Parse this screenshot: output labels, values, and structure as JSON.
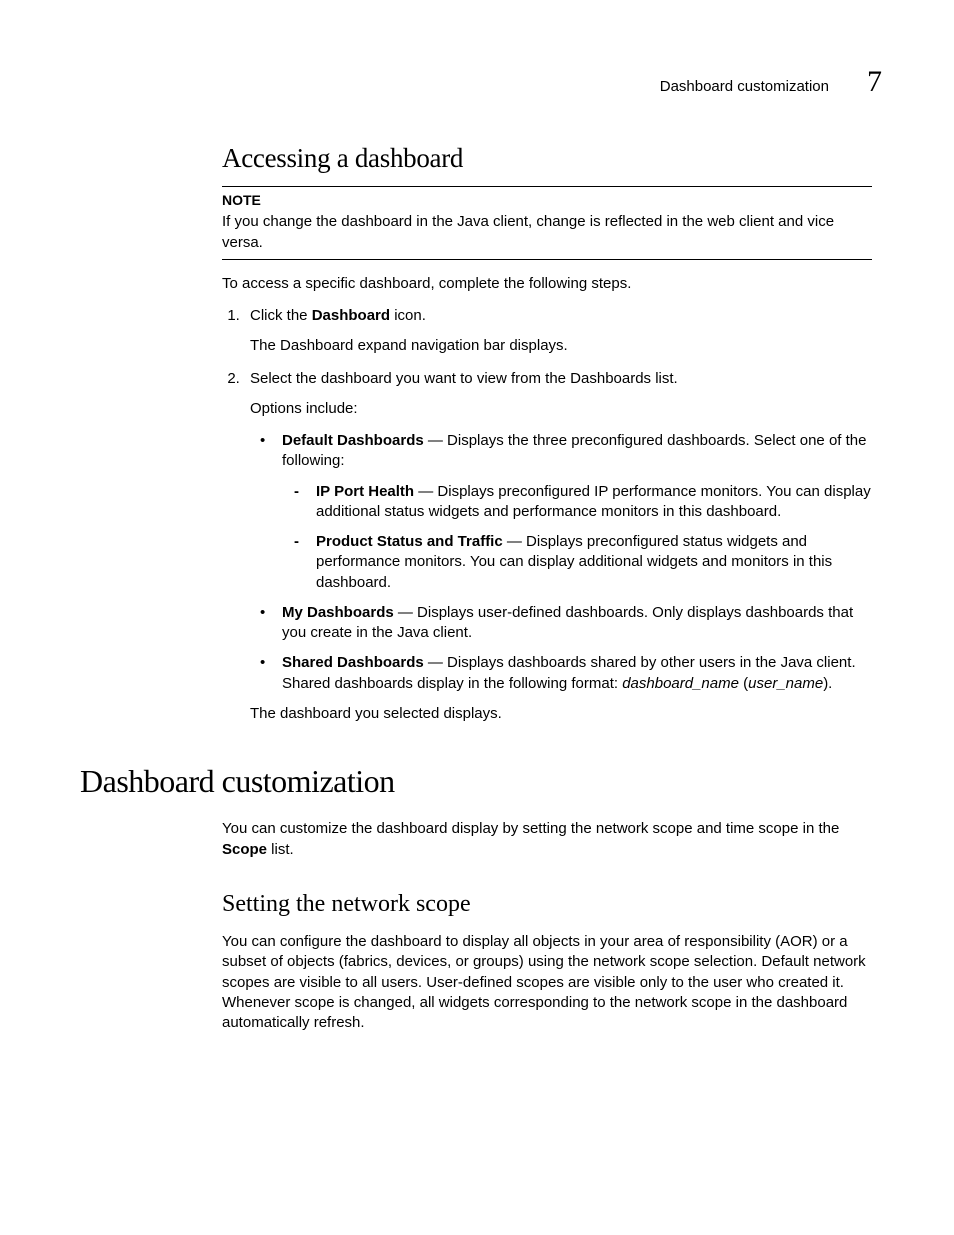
{
  "header": {
    "running_title": "Dashboard customization",
    "chapter_number": "7"
  },
  "section1": {
    "heading": "Accessing a dashboard",
    "note_label": "NOTE",
    "note_text": "If you change the dashboard in the Java client, change is reflected in the web client and vice versa.",
    "intro": "To access a specific dashboard, complete the following steps.",
    "step1_pre": "Click the ",
    "step1_bold": "Dashboard",
    "step1_post": " icon.",
    "step1_result": "The Dashboard expand navigation bar displays.",
    "step2": "Select the dashboard you want to view from the Dashboards list.",
    "step2_options_label": "Options include:",
    "opt_default_label": "Default Dashboards",
    "opt_default_text": " — Displays the three preconfigured dashboards. Select one of the following:",
    "opt_ip_label": "IP Port Health",
    "opt_ip_text": " — Displays preconfigured IP performance monitors. You can display additional status widgets and performance monitors in this dashboard.",
    "opt_prod_label": "Product Status and Traffic",
    "opt_prod_text": " — Displays preconfigured status widgets and performance monitors. You can display additional widgets and monitors in this dashboard.",
    "opt_my_label": "My Dashboards",
    "opt_my_text": " — Displays user-defined dashboards. Only displays dashboards that you create in the Java client.",
    "opt_shared_label": "Shared Dashboards",
    "opt_shared_text_pre": " — Displays dashboards shared by other users in the Java client. Shared dashboards display in the following format: ",
    "opt_shared_italic1": "dashboard_name",
    "opt_shared_mid": " (",
    "opt_shared_italic2": "user_name",
    "opt_shared_end": ").",
    "step2_result": "The dashboard you selected displays."
  },
  "section2": {
    "heading": "Dashboard customization",
    "para_pre": "You can customize the dashboard display by setting the network scope and time scope in the ",
    "para_bold": "Scope",
    "para_post": " list.",
    "sub_heading": "Setting the network scope",
    "sub_para": "You can configure the dashboard to display all objects in your area of responsibility (AOR) or a subset of objects (fabrics, devices, or groups) using the network scope selection. Default network scopes are visible to all users. User-defined scopes are visible only to the user who created it. Whenever scope is changed, all widgets corresponding to the network scope in the dashboard automatically refresh."
  }
}
